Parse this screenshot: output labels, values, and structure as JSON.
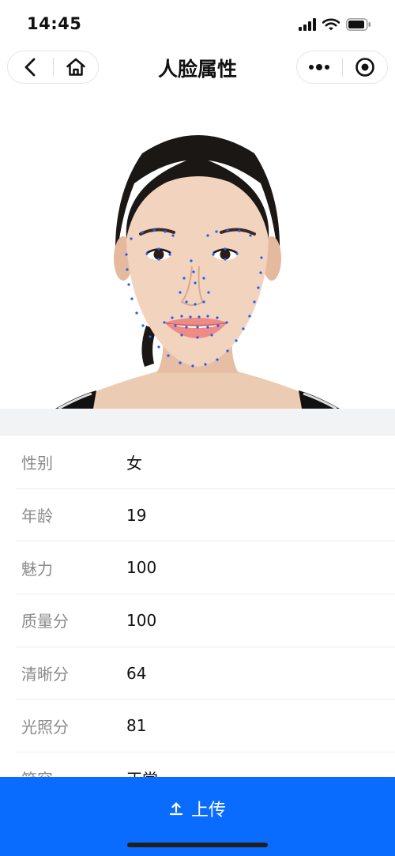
{
  "status": {
    "time": "14:45"
  },
  "nav": {
    "title": "人脸属性"
  },
  "attributes": [
    {
      "label": "性别",
      "value": "女"
    },
    {
      "label": "年龄",
      "value": "19"
    },
    {
      "label": "魅力",
      "value": "100"
    },
    {
      "label": "质量分",
      "value": "100"
    },
    {
      "label": "清晰分",
      "value": "64"
    },
    {
      "label": "光照分",
      "value": "81"
    },
    {
      "label": "笑容",
      "value": "正常"
    }
  ],
  "upload": {
    "label": "上传"
  },
  "colors": {
    "accent": "#0a6cff",
    "landmark": "#1f5bff"
  }
}
